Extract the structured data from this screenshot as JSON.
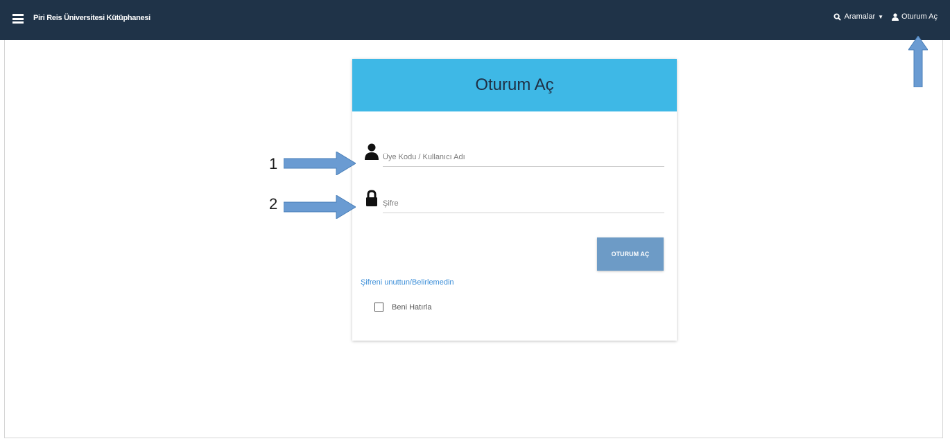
{
  "navbar": {
    "title": "Piri Reis Üniversitesi Kütüphanesi",
    "search_label": "Aramalar",
    "login_label": "Oturum Aç"
  },
  "card": {
    "title": "Oturum Aç",
    "username_placeholder": "Üye Kodu / Kullanıcı Adı",
    "password_placeholder": "Şifre",
    "login_button": "OTURUM AÇ",
    "forgot_link": "Şifreni unuttun/Belirlemedin",
    "remember_label": "Beni Hatırla"
  },
  "annotations": {
    "label_1": "1",
    "label_2": "2"
  },
  "colors": {
    "navbar_bg": "#1f3348",
    "header_bg": "#3eb8e6",
    "button_bg": "#6d9bc6",
    "arrow": "#6a9bd2",
    "link": "#3b8ed8"
  },
  "icons": {
    "menu": "hamburger-menu-icon",
    "search": "search-icon",
    "user": "user-icon",
    "lock": "lock-icon"
  }
}
